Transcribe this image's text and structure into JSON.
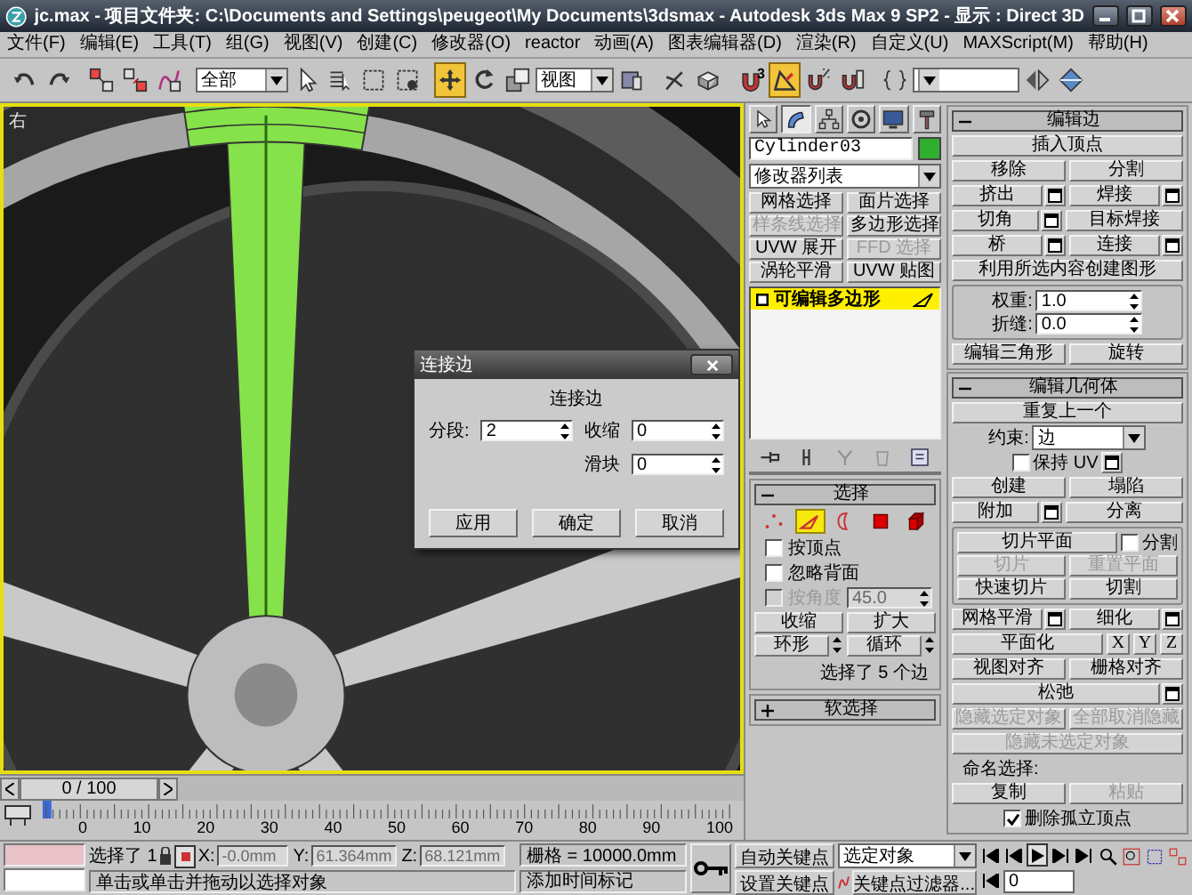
{
  "window": {
    "title": "jc.max - 项目文件夹: C:\\Documents and Settings\\peugeot\\My Documents\\3dsmax - Autodesk 3ds Max 9 SP2 - 显示 : Direct 3D"
  },
  "menu": [
    "文件(F)",
    "编辑(E)",
    "工具(T)",
    "组(G)",
    "视图(V)",
    "创建(C)",
    "修改器(O)",
    "reactor",
    "动画(A)",
    "图表编辑器(D)",
    "渲染(R)",
    "自定义(U)",
    "MAXScript(M)",
    "帮助(H)"
  ],
  "toolbar": {
    "groups": [
      [
        {
          "kind": "undo",
          "selected": false
        },
        {
          "kind": "redo",
          "selected": false
        }
      ],
      [
        {
          "kind": "link",
          "selected": false
        },
        {
          "kind": "unlink",
          "selected": false
        },
        {
          "kind": "bind",
          "selected": false
        }
      ],
      [
        {
          "kind": "dropdown",
          "value": "全部"
        },
        {
          "kind": "select",
          "selected": false
        },
        {
          "kind": "select_name",
          "selected": false
        },
        {
          "kind": "region",
          "selected": false
        },
        {
          "kind": "window",
          "selected": false
        }
      ],
      [
        {
          "kind": "move",
          "selected": true
        },
        {
          "kind": "rotate",
          "selected": false
        },
        {
          "kind": "scale",
          "selected": false
        },
        {
          "kind": "dropdown",
          "value": "视图"
        },
        {
          "kind": "pivot",
          "selected": false
        }
      ],
      [
        {
          "kind": "manipulate",
          "selected": false
        },
        {
          "kind": "keyboard",
          "selected": false
        }
      ],
      [
        {
          "kind": "snap",
          "label": "3",
          "selected": false
        },
        {
          "kind": "angle_snap",
          "selected": true
        },
        {
          "kind": "percent_snap",
          "selected": false
        },
        {
          "kind": "spinner_snap",
          "selected": false
        }
      ],
      [
        {
          "kind": "named_sets",
          "selected": false
        },
        {
          "kind": "dropdown"
        },
        {
          "kind": "mirror",
          "selected": false
        },
        {
          "kind": "align",
          "selected": false
        }
      ]
    ]
  },
  "viewport": {
    "label": "右"
  },
  "dialog": {
    "title": "连接边",
    "group": "连接边",
    "fields": [
      {
        "label": "分段:",
        "value": "2"
      },
      {
        "label": "收缩",
        "value": "0"
      },
      {
        "label": "滑块",
        "value": "0"
      }
    ],
    "buttons": [
      "应用",
      "确定",
      "取消"
    ]
  },
  "command_panel": {
    "tabs": [
      {
        "kind": "create",
        "selected": false
      },
      {
        "kind": "modify",
        "selected": true
      },
      {
        "kind": "hierarchy",
        "selected": false
      },
      {
        "kind": "motion",
        "selected": false
      },
      {
        "kind": "display",
        "selected": false
      },
      {
        "kind": "utilities",
        "selected": false
      }
    ],
    "object_name": "Cylinder03",
    "modifier_list": "修改器列表",
    "modifier_buttons": [
      {
        "label": "网格选择",
        "disabled": false
      },
      {
        "label": "面片选择",
        "disabled": false
      },
      {
        "label": "样条线选择",
        "disabled": true
      },
      {
        "label": "多边形选择",
        "disabled": false
      },
      {
        "label": "UVW 展开",
        "disabled": false
      },
      {
        "label": "FFD 选择",
        "disabled": true
      },
      {
        "label": "涡轮平滑",
        "disabled": false
      },
      {
        "label": "UVW 贴图",
        "disabled": false
      }
    ],
    "stack": [
      {
        "label": "可编辑多边形",
        "selected": true
      }
    ],
    "stack_tools": [
      {
        "kind": "pin",
        "disabled": false
      },
      {
        "kind": "show_result",
        "disabled": false
      },
      {
        "kind": "unique",
        "disabled": true
      },
      {
        "kind": "remove",
        "disabled": true
      },
      {
        "kind": "configure",
        "disabled": false
      }
    ],
    "selection": {
      "title": "选择",
      "expanded": true,
      "levels": [
        {
          "kind": "vertex",
          "selected": false
        },
        {
          "kind": "edge",
          "selected": true
        },
        {
          "kind": "border",
          "selected": false
        },
        {
          "kind": "polygon",
          "selected": false
        },
        {
          "kind": "element",
          "selected": false
        }
      ],
      "options": [
        {
          "label": "按顶点",
          "checked": false,
          "disabled": false
        },
        {
          "label": "忽略背面",
          "checked": false,
          "disabled": false
        },
        {
          "label": "按角度",
          "checked": false,
          "disabled": true,
          "value": "45.0"
        }
      ],
      "buttons": [
        {
          "label": "收缩",
          "kind": "button"
        },
        {
          "label": "扩大",
          "kind": "button"
        },
        {
          "label": "环形",
          "kind": "spin_button"
        },
        {
          "label": "循环",
          "kind": "spin_button"
        }
      ],
      "summary": "选择了 5 个边"
    },
    "soft_selection": {
      "title": "软选择",
      "expanded": false
    },
    "rollouts": [
      {
        "title": "编辑边",
        "expanded": true,
        "blocks": [
          {
            "kind": "row",
            "items": [
              {
                "kind": "button",
                "label": "插入顶点",
                "disabled": false
              }
            ]
          },
          {
            "kind": "row",
            "items": [
              {
                "kind": "button",
                "label": "移除",
                "disabled": false
              },
              {
                "kind": "button",
                "label": "分割",
                "disabled": false
              }
            ]
          },
          {
            "kind": "row",
            "items": [
              {
                "kind": "option_button",
                "label": "挤出",
                "disabled": false
              },
              {
                "kind": "option_button",
                "label": "焊接",
                "disabled": false
              }
            ]
          },
          {
            "kind": "row",
            "items": [
              {
                "kind": "option_button",
                "label": "切角",
                "disabled": false
              },
              {
                "kind": "button",
                "label": "目标焊接",
                "disabled": false
              }
            ]
          },
          {
            "kind": "row",
            "items": [
              {
                "kind": "option_button",
                "label": "桥",
                "disabled": false
              },
              {
                "kind": "option_button",
                "label": "连接",
                "disabled": false
              }
            ]
          },
          {
            "kind": "row",
            "items": [
              {
                "kind": "button",
                "label": "利用所选内容创建图形",
                "disabled": false
              }
            ]
          },
          {
            "kind": "group",
            "rows": [
              {
                "items": [
                  {
                    "kind": "spinner",
                    "label": "权重:",
                    "value": "1.0"
                  }
                ]
              },
              {
                "items": [
                  {
                    "kind": "spinner",
                    "label": "折缝:",
                    "value": "0.0"
                  }
                ]
              }
            ]
          },
          {
            "kind": "row",
            "items": [
              {
                "kind": "button",
                "label": "编辑三角形",
                "disabled": false
              },
              {
                "kind": "button",
                "label": "旋转",
                "disabled": false
              }
            ]
          }
        ]
      },
      {
        "title": "编辑几何体",
        "expanded": true,
        "blocks": [
          {
            "kind": "row",
            "items": [
              {
                "kind": "button",
                "label": "重复上一个",
                "disabled": false
              }
            ]
          },
          {
            "kind": "row",
            "items": [
              {
                "kind": "dropdown",
                "label": "约束:",
                "value": "边"
              }
            ]
          },
          {
            "kind": "row",
            "items": [
              {
                "kind": "check",
                "label": "保持 UV",
                "checked": false,
                "disabled": false
              },
              {
                "kind": "settings",
                "disabled": false
              }
            ]
          },
          {
            "kind": "row",
            "items": [
              {
                "kind": "button",
                "label": "创建",
                "disabled": false
              },
              {
                "kind": "button",
                "label": "塌陷",
                "disabled": false
              }
            ]
          },
          {
            "kind": "row",
            "items": [
              {
                "kind": "option_button",
                "label": "附加",
                "disabled": false
              },
              {
                "kind": "button",
                "label": "分离",
                "disabled": false
              }
            ]
          },
          {
            "kind": "group",
            "rows": [
              {
                "items": [
                  {
                    "kind": "button",
                    "label": "切片平面",
                    "disabled": false
                  },
                  {
                    "kind": "check",
                    "label": "分割",
                    "checked": false,
                    "disabled": false
                  }
                ]
              },
              {
                "items": [
                  {
                    "kind": "button",
                    "label": "切片",
                    "disabled": true
                  },
                  {
                    "kind": "button",
                    "label": "重置平面",
                    "disabled": true
                  }
                ]
              },
              {
                "items": [
                  {
                    "kind": "button",
                    "label": "快速切片",
                    "disabled": false
                  },
                  {
                    "kind": "button",
                    "label": "切割",
                    "disabled": false
                  }
                ]
              }
            ]
          },
          {
            "kind": "row",
            "items": [
              {
                "kind": "option_button",
                "label": "网格平滑",
                "disabled": false
              },
              {
                "kind": "option_button",
                "label": "细化",
                "disabled": false
              }
            ]
          },
          {
            "kind": "row",
            "items": [
              {
                "kind": "button",
                "label": "平面化",
                "disabled": false
              },
              {
                "kind": "small_button",
                "label": "X",
                "disabled": false
              },
              {
                "kind": "small_button",
                "label": "Y",
                "disabled": false
              },
              {
                "kind": "small_button",
                "label": "Z",
                "disabled": false
              }
            ]
          },
          {
            "kind": "row",
            "items": [
              {
                "kind": "button",
                "label": "视图对齐",
                "disabled": false
              },
              {
                "kind": "button",
                "label": "栅格对齐",
                "disabled": false
              }
            ]
          },
          {
            "kind": "row",
            "items": [
              {
                "kind": "option_button",
                "label": "松弛",
                "disabled": false
              }
            ]
          },
          {
            "kind": "row",
            "items": [
              {
                "kind": "button",
                "label": "隐藏选定对象",
                "disabled": true
              },
              {
                "kind": "button",
                "label": "全部取消隐藏",
                "disabled": true
              }
            ]
          },
          {
            "kind": "row",
            "items": [
              {
                "kind": "button",
                "label": "隐藏未选定对象",
                "disabled": true
              }
            ]
          },
          {
            "kind": "row",
            "items": [
              {
                "kind": "text",
                "label": "命名选择:"
              }
            ]
          },
          {
            "kind": "row",
            "items": [
              {
                "kind": "button",
                "label": "复制",
                "disabled": false
              },
              {
                "kind": "button",
                "label": "粘贴",
                "disabled": true
              }
            ]
          },
          {
            "kind": "row",
            "items": [
              {
                "kind": "check",
                "label": "删除孤立顶点",
                "checked": true,
                "disabled": false
              }
            ]
          }
        ]
      }
    ]
  },
  "timeline": {
    "position": "0 / 100",
    "ruler": [
      "0",
      "10",
      "20",
      "30",
      "40",
      "50",
      "60",
      "70",
      "80",
      "90",
      "100"
    ]
  },
  "status": {
    "selection_label": "选择了 1",
    "coords": [
      {
        "label": "X:",
        "value": "-0.0mm",
        "disabled": true
      },
      {
        "label": "Y:",
        "value": "61.364mm",
        "disabled": true
      },
      {
        "label": "Z:",
        "value": "68.121mm",
        "disabled": true
      }
    ],
    "grid": "栅格 = 10000.0mm",
    "prompt": "单击或单击并拖动以选择对象",
    "time_tag": "添加时间标记",
    "auto_key": {
      "label": "自动关键点",
      "on": false
    },
    "set_key": "设置关键点",
    "key_mode": "选定对象",
    "key_filters": "关键点过滤器...",
    "frame": "0"
  }
}
